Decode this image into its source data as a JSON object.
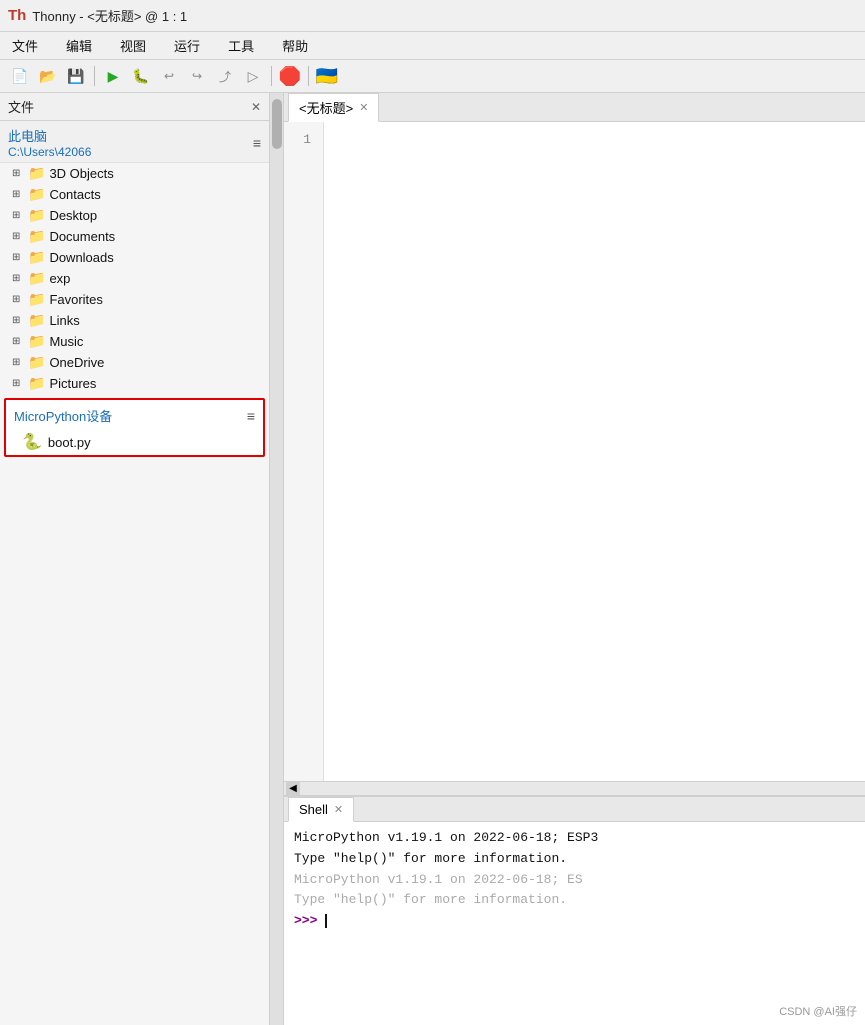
{
  "titleBar": {
    "icon": "Th",
    "title": "Thonny  -  <无标题>  @  1 : 1"
  },
  "menuBar": {
    "items": [
      "文件",
      "编辑",
      "视图",
      "运行",
      "工具",
      "帮助"
    ]
  },
  "toolbar": {
    "buttons": [
      "new",
      "open",
      "save",
      "run",
      "debug",
      "stepover",
      "stepinto",
      "stepout",
      "resume",
      "stop",
      "flag"
    ]
  },
  "filePanel": {
    "title": "文件",
    "pcSection": {
      "title": "此电脑",
      "path": "C:\\Users\\42066"
    },
    "folders": [
      "3D Objects",
      "Contacts",
      "Desktop",
      "Documents",
      "Downloads",
      "exp",
      "Favorites",
      "Links",
      "Music",
      "OneDrive",
      "Pictures"
    ],
    "micropythonSection": {
      "title": "MicroPython设备",
      "files": [
        "boot.py"
      ]
    }
  },
  "editor": {
    "tab": "<无标题>",
    "lineNumbers": [
      "1"
    ],
    "code": ""
  },
  "shell": {
    "tab": "Shell",
    "lines": [
      {
        "type": "dark",
        "text": "  MicroPython v1.19.1 on 2022-06-18; ESP3"
      },
      {
        "type": "dark",
        "text": "  Type \"help()\" for more information."
      },
      {
        "type": "gray",
        "text": "MicroPython v1.19.1 on 2022-06-18; ES"
      },
      {
        "type": "gray",
        "text": "Type \"help()\" for more information."
      }
    ],
    "prompt": ">>> "
  },
  "watermark": "CSDN @AI强仔"
}
